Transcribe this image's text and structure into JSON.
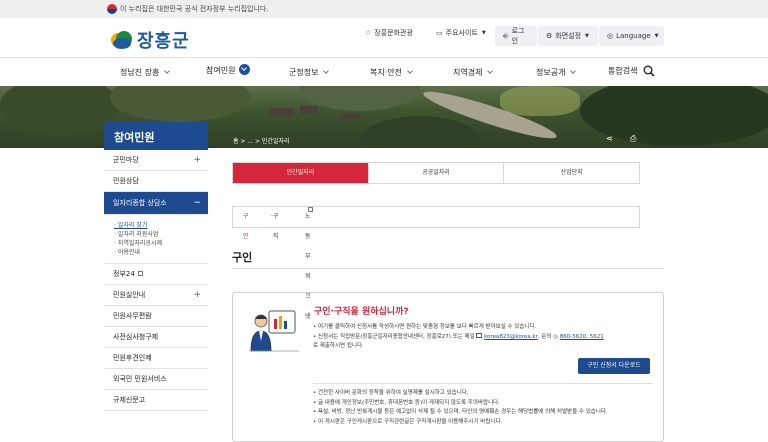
{
  "gov_banner": {
    "text": "이 누리집은 대한민국 공식 전자정부 누리집입니다."
  },
  "header": {
    "logo_text": "장흥군",
    "culture_link": "장흥문화관광",
    "sites_label": "주요사이트",
    "login_label": "로그인",
    "screen_label": "화면설정",
    "language_label": "Language"
  },
  "gnb": {
    "items": [
      "정남진 장흥",
      "참여민원",
      "군정정보",
      "복지·안전",
      "지역경제",
      "정보공개",
      "통합검색"
    ]
  },
  "banner": {
    "section_title": "참여민원",
    "breadcrumb": "홈 > ... > 민간일자리"
  },
  "sidebar": {
    "items": [
      "군민마당",
      "민원상담",
      "일자리종합 상담소",
      "정부24",
      "민원실안내",
      "민원사무편람",
      "사전심사청구제",
      "민원후견인제",
      "외국민 민원서비스",
      "규제신문고"
    ],
    "sub_items": [
      "일자리 찾기",
      "일자리 지원사업",
      "지역일자리공시제",
      "이용안내"
    ]
  },
  "tabs": [
    "민간일자리",
    "공공일자리",
    "산업단지"
  ],
  "subtabs": [
    "구인",
    "구직",
    "노동부워크넷"
  ],
  "content": {
    "heading": "구인",
    "box_title": "구인·구직을 원하십니까?",
    "bullet1": "여기를 클릭하여 신청서를 작성하시면 원하는 맞춤형 정보를 보다 빠르게 받아보실 수 있습니다.",
    "bullet2_prefix": "신청서는 직접방문(장흥군일자리종합안내센터, 장흥로27) 또는 메일",
    "email": "korea823@korea.kr",
    "bullet2_mid": ", 문의",
    "phone": "860-5620, 5621",
    "bullet2_suffix": "로 제출하시면 됩니다.",
    "download_button": "구인 신청서 다운로드",
    "notes": [
      "건전한 사이버 문화의 정착을 위하여 실명제를 실시하고 있습니다.",
      "글 내용에 개인정보(주민번호, 휴대폰번호 등)이 게재되지 않도록 주의바랍니다.",
      "욕설, 비방, 정난 반복게시물 등은 예고없이 삭제 될 수 있으며, 타인의 명예훼손 경우는 해당법률에 의해 처벌받을 수 있습니다.",
      "이 게시판은 구인게시판으로 구직관련글은 구직게시판을 이용해주시기 바랍니다."
    ]
  },
  "colors": {
    "primary": "#1e4a8f",
    "accent": "#d5273c"
  }
}
